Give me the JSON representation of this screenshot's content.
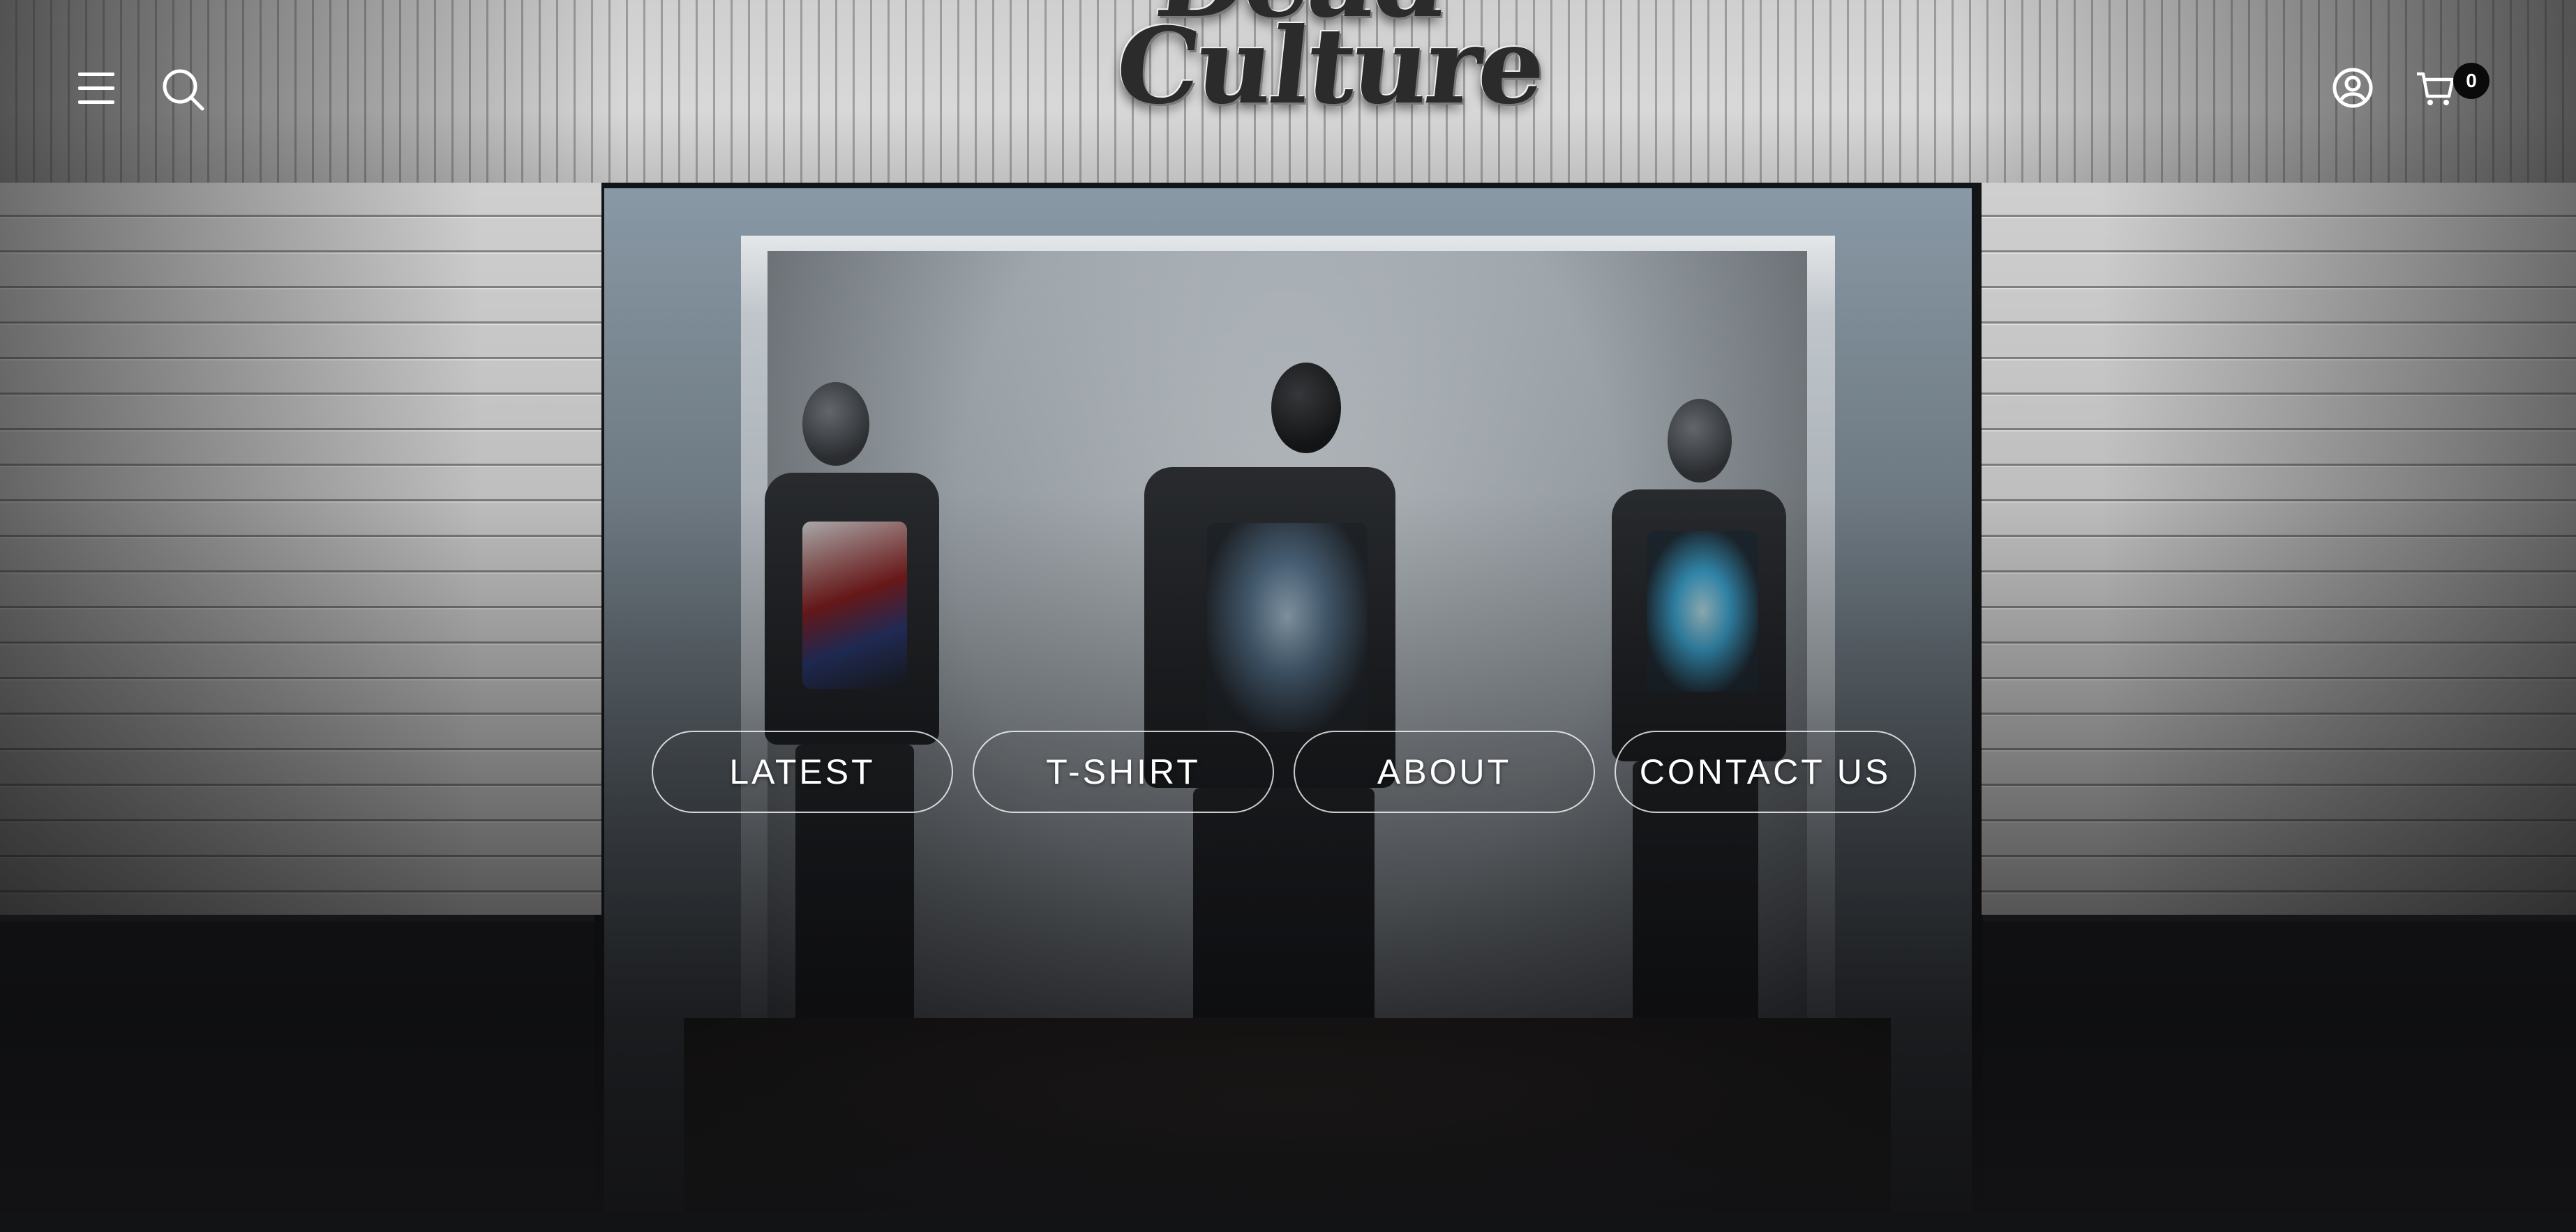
{
  "header": {
    "menu_icon": "hamburger-menu-icon",
    "search_icon": "search-icon",
    "logo_text_line1": "Dead",
    "logo_text_line2": "Culture",
    "account_icon": "user-account-icon",
    "cart_icon": "shopping-cart-icon",
    "cart_count": "0"
  },
  "nav": {
    "buttons": [
      {
        "label": "LATEST"
      },
      {
        "label": "T-SHIRT"
      },
      {
        "label": "ABOUT"
      },
      {
        "label": "CONTACT US"
      }
    ]
  },
  "colors": {
    "text": "#ffffff",
    "badge_bg": "#0a0a0a",
    "button_border": "#ffffff",
    "page_bg": "#141516"
  }
}
